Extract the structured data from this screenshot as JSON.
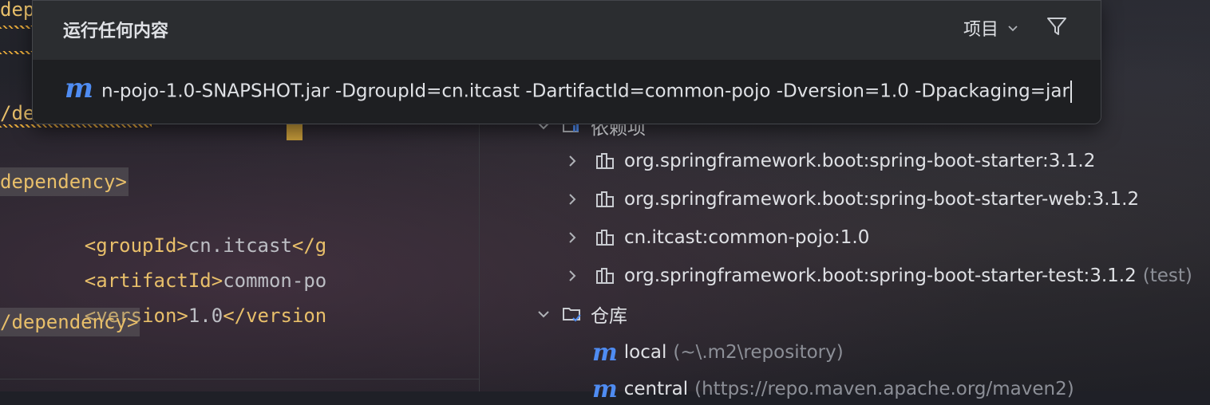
{
  "popup": {
    "title": "运行任何内容",
    "scope_label": "项目",
    "input_value": "n-pojo-1.0-SNAPSHOT.jar -DgroupId=cn.itcast -DartifactId=common-pojo -Dversion=1.0 -Dpackaging=jar"
  },
  "editor": {
    "line_dep_top": "dep",
    "line_dep_close": "/de",
    "dep_open": "dependency>",
    "group_tag_open": "<groupId>",
    "group_value": "cn.itcast",
    "group_tag_close": "</g",
    "artifact_tag_open": "<artifactId>",
    "artifact_value": "common-po",
    "version_tag_open": "<version>",
    "version_value": "1.0",
    "version_tag_close": "</version",
    "dep_close": "/dependency>"
  },
  "tree": {
    "deps_label": "依赖项",
    "dependencies": [
      {
        "label": "org.springframework.boot:spring-boot-starter:3.1.2",
        "suffix": ""
      },
      {
        "label": "org.springframework.boot:spring-boot-starter-web:3.1.2",
        "suffix": ""
      },
      {
        "label": "cn.itcast:common-pojo:1.0",
        "suffix": ""
      },
      {
        "label": "org.springframework.boot:spring-boot-starter-test:3.1.2",
        "suffix": "(test)"
      }
    ],
    "repos_label": "仓库",
    "repos": [
      {
        "label": "local",
        "suffix": "(~\\.m2\\repository)"
      },
      {
        "label": "central",
        "suffix": "(https://repo.maven.apache.org/maven2)"
      }
    ]
  },
  "icons": {
    "maven_glyph": "m"
  },
  "colors": {
    "accent": "#4f8cf2",
    "xml_tag": "#e8bf6a",
    "popup_bg": "#2b2d30"
  }
}
